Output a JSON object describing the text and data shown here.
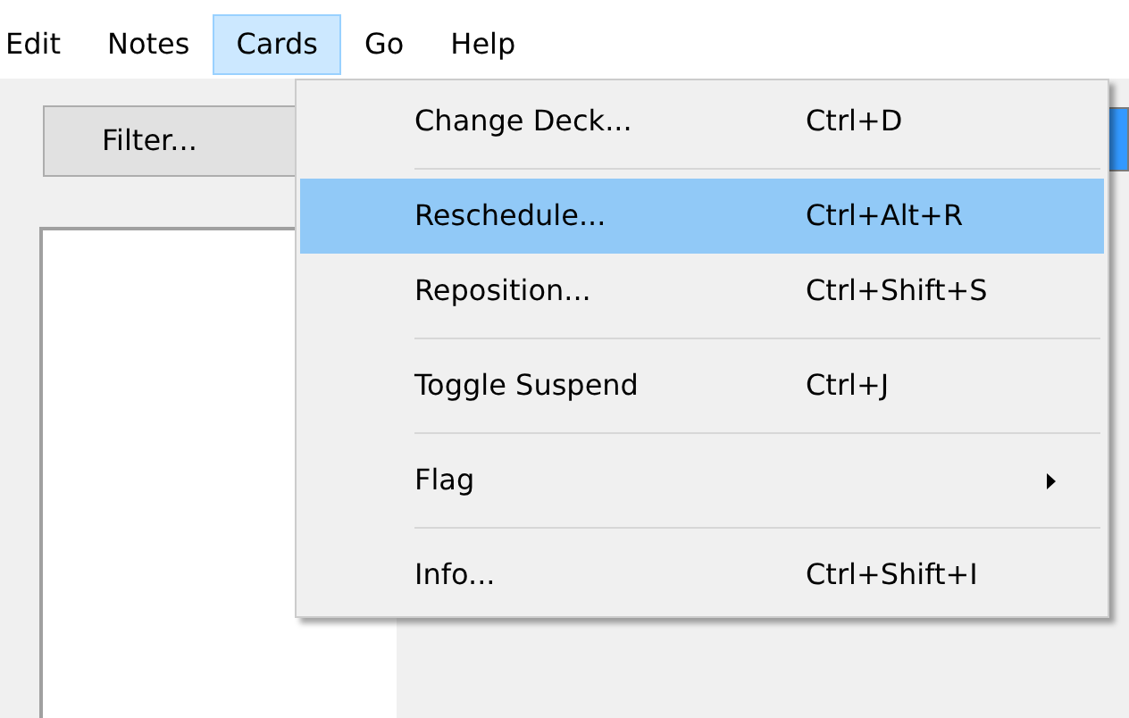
{
  "menubar": [
    {
      "label": "Edit",
      "selected": false
    },
    {
      "label": "Notes",
      "selected": false
    },
    {
      "label": "Cards",
      "selected": true
    },
    {
      "label": "Go",
      "selected": false
    },
    {
      "label": "Help",
      "selected": false
    }
  ],
  "toolbar": {
    "filter_button": "Filter..."
  },
  "menu": {
    "items": [
      {
        "kind": "item",
        "label": "Change Deck...",
        "shortcut": "Ctrl+D",
        "selected": false
      },
      {
        "kind": "separator"
      },
      {
        "kind": "item",
        "label": "Reschedule...",
        "shortcut": "Ctrl+Alt+R",
        "selected": true
      },
      {
        "kind": "item",
        "label": "Reposition...",
        "shortcut": "Ctrl+Shift+S",
        "selected": false
      },
      {
        "kind": "separator"
      },
      {
        "kind": "item",
        "label": "Toggle Suspend",
        "shortcut": "Ctrl+J",
        "selected": false
      },
      {
        "kind": "separator"
      },
      {
        "kind": "submenu",
        "label": "Flag",
        "selected": false
      },
      {
        "kind": "separator"
      },
      {
        "kind": "item",
        "label": "Info...",
        "shortcut": "Ctrl+Shift+I",
        "selected": false
      }
    ]
  }
}
